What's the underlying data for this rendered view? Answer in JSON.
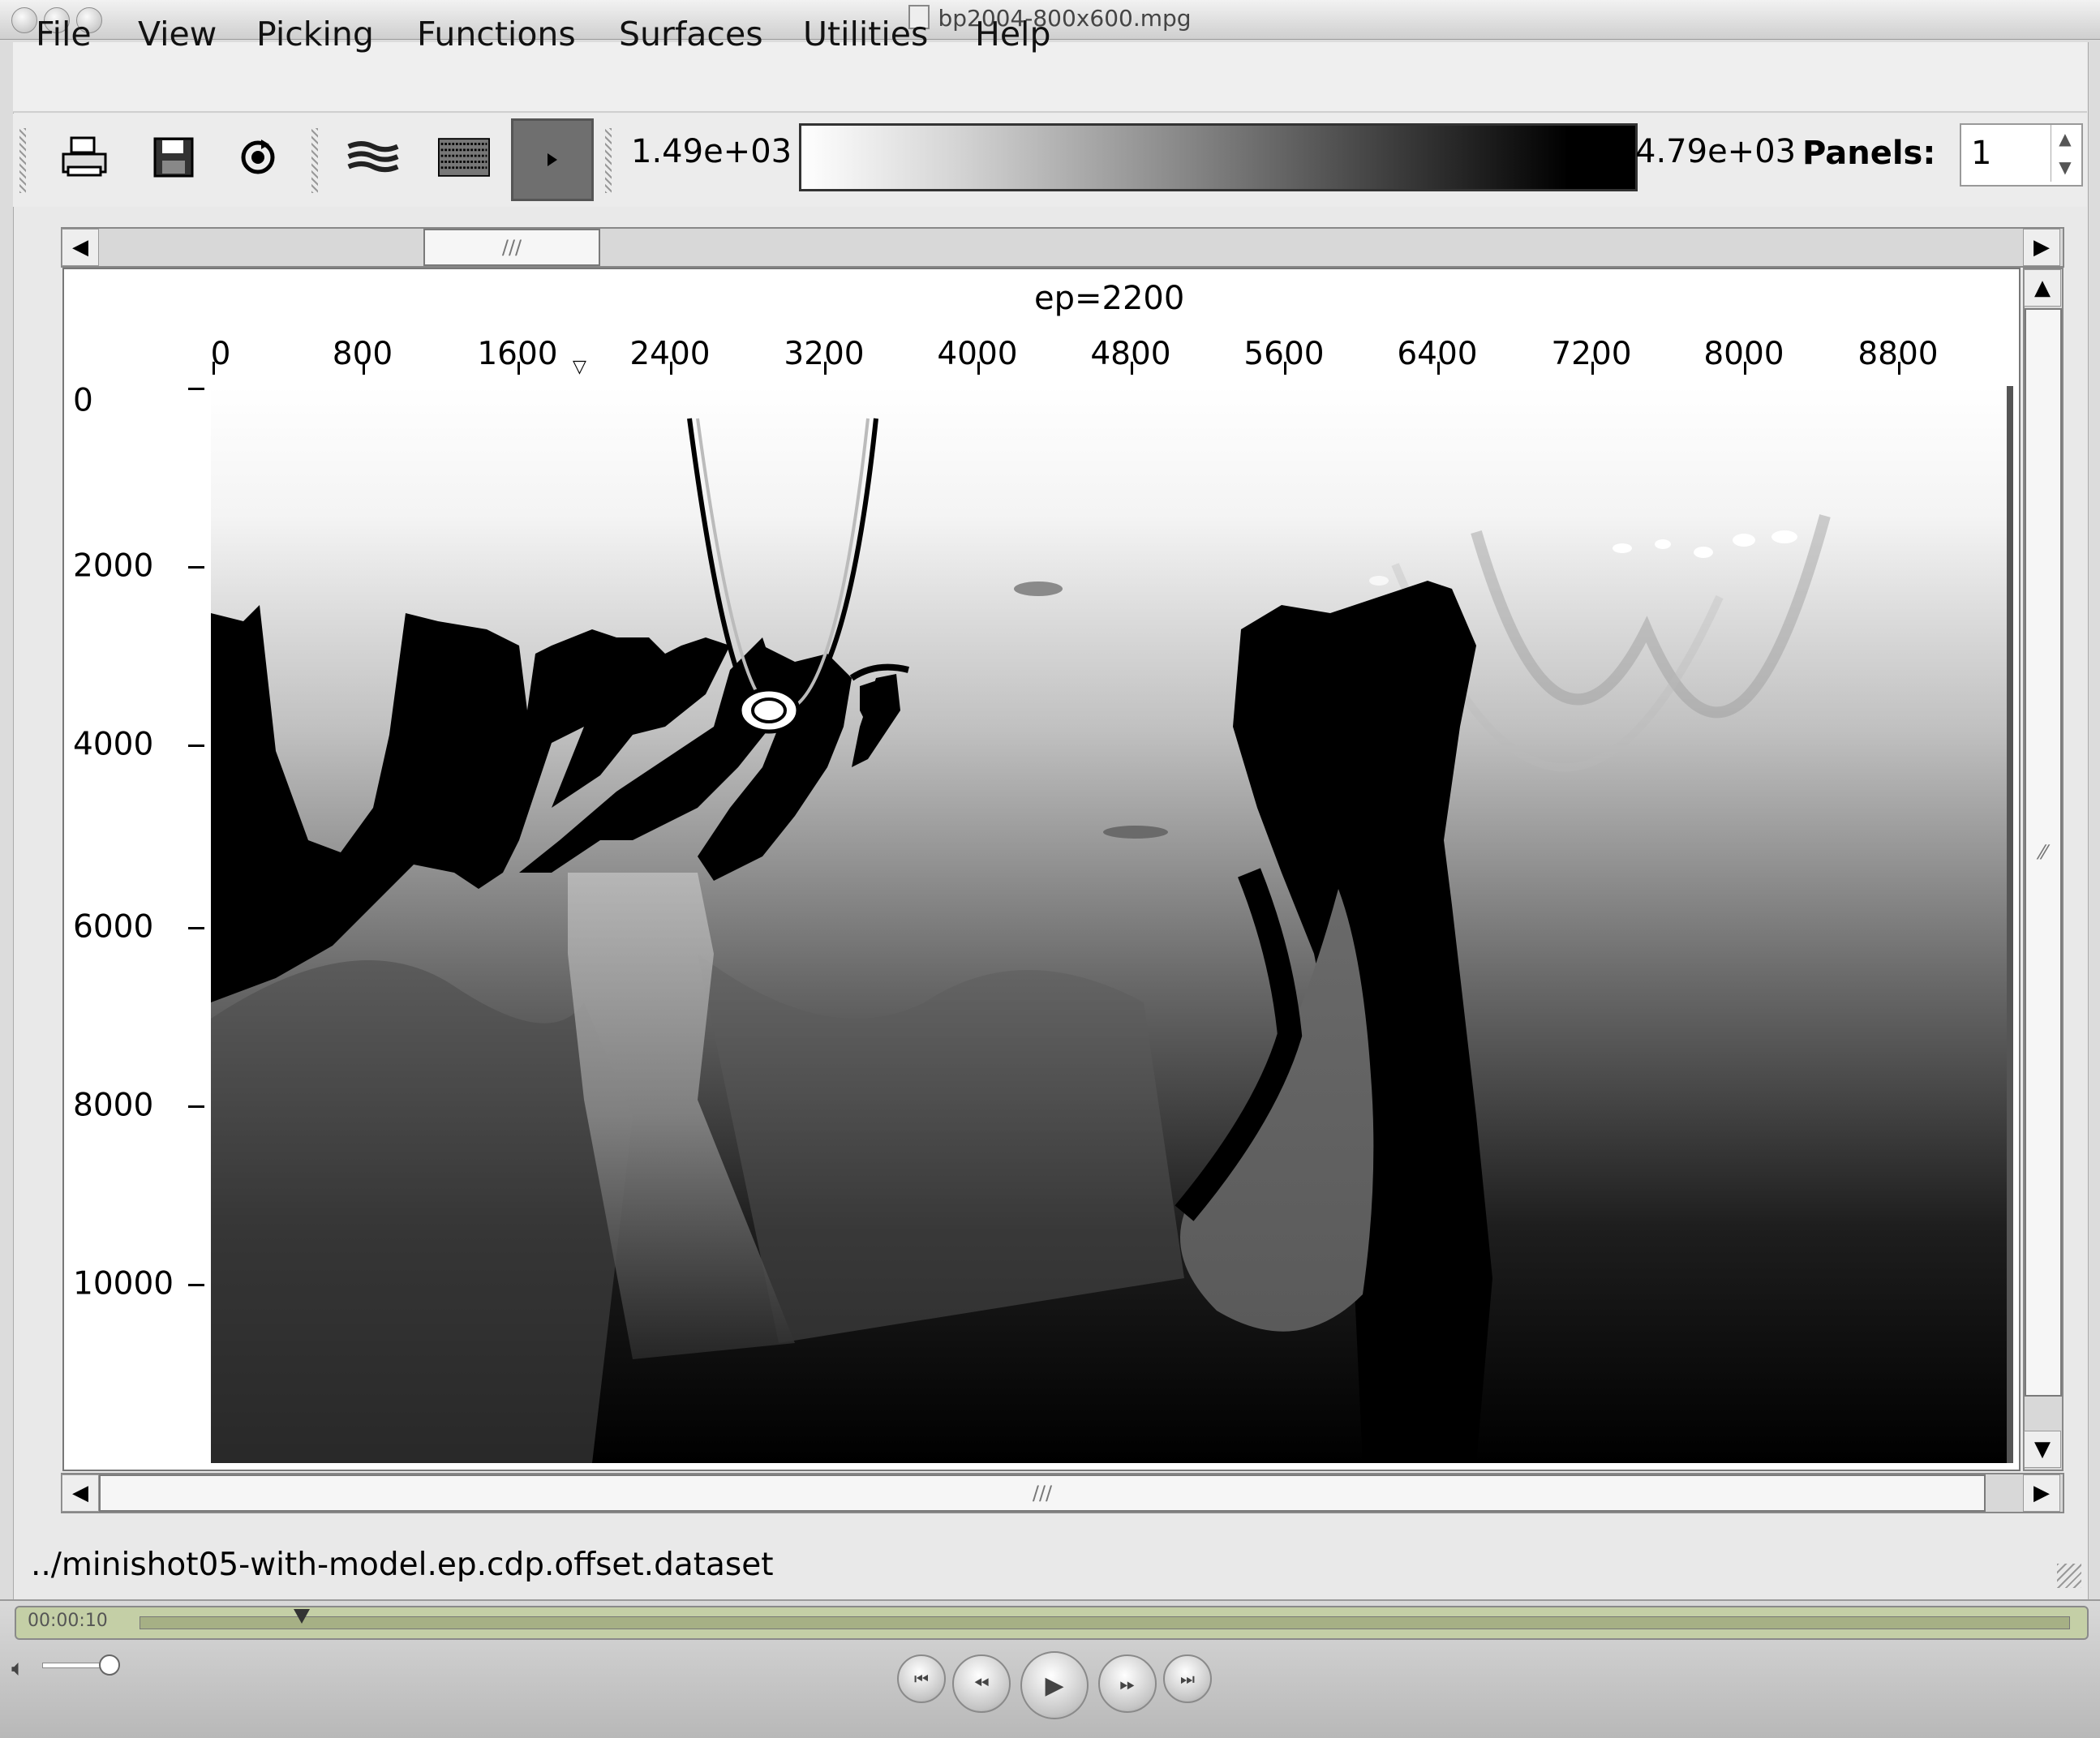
{
  "window": {
    "title": "bp2004-800x600.mpg"
  },
  "menu": [
    "File",
    "View",
    "Picking",
    "Functions",
    "Surfaces",
    "Utilities",
    "Help"
  ],
  "toolbar": {
    "buttons": [
      "print-icon",
      "save-icon",
      "refresh-icon",
      "wiggle-display-icon",
      "density-display-icon",
      "play-forward-icon"
    ],
    "colorbar_min": "1.49e+03",
    "colorbar_max": "4.79e+03",
    "panels_label": "Panels:",
    "panels_value": "1"
  },
  "plot": {
    "title": "ep=2200",
    "x_ticks": [
      "0",
      "800",
      "1600",
      "2400",
      "3200",
      "4000",
      "4800",
      "5600",
      "6400",
      "7200",
      "8000",
      "8800"
    ],
    "y_ticks": [
      "0",
      "2000",
      "4000",
      "6000",
      "8000",
      "10000"
    ]
  },
  "status": {
    "path": "../minishot05-with-model.ep.cdp.offset.dataset"
  },
  "player": {
    "time": "00:00:10",
    "playhead_fraction": 0.084
  }
}
